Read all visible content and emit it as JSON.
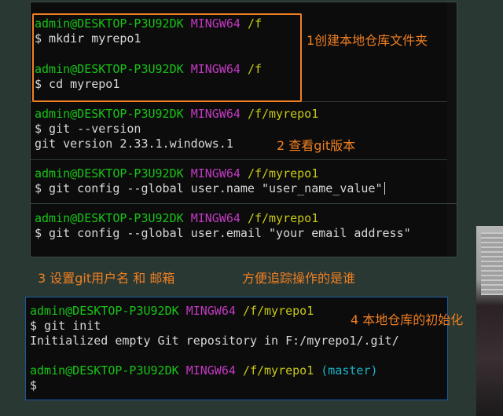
{
  "terminal1": {
    "blocks": [
      {
        "user": "admin@DESKTOP-P3U92DK",
        "sys": "MINGW64",
        "path": "/f",
        "cmd": "$ mkdir myrepo1",
        "output": ""
      },
      {
        "user": "admin@DESKTOP-P3U92DK",
        "sys": "MINGW64",
        "path": "/f",
        "cmd": "$ cd myrepo1",
        "output": ""
      },
      {
        "user": "admin@DESKTOP-P3U92DK",
        "sys": "MINGW64",
        "path": "/f/myrepo1",
        "cmd": "$ git --version",
        "output": "git version 2.33.1.windows.1"
      },
      {
        "user": "admin@DESKTOP-P3U92DK",
        "sys": "MINGW64",
        "path": "/f/myrepo1",
        "cmd": "$ git config --global user.name \"user_name_value\"",
        "output": ""
      },
      {
        "user": "admin@DESKTOP-P3U92DK",
        "sys": "MINGW64",
        "path": "/f/myrepo1",
        "cmd": "$ git config --global user.email \"your email address\"",
        "output": ""
      }
    ]
  },
  "terminal2": {
    "blocks": [
      {
        "user": "admin@DESKTOP-P3U92DK",
        "sys": "MINGW64",
        "path": "/f/myrepo1",
        "branch": "",
        "cmd": "$ git init",
        "output": "Initialized empty Git repository in F:/myrepo1/.git/"
      },
      {
        "user": "admin@DESKTOP-P3U92DK",
        "sys": "MINGW64",
        "path": "/f/myrepo1",
        "branch": "(master)",
        "cmd": "$",
        "output": ""
      }
    ]
  },
  "annotations": {
    "note1": "1创建本地仓库文件夹",
    "note2": "2 查看git版本",
    "note3a": "3 设置git用户名 和 邮箱",
    "note3b": "方便追踪操作的是谁",
    "note4": "4 本地仓库的初始化"
  },
  "colors": {
    "annotation": "#f07f22",
    "user": "#17c417",
    "system": "#c23ac2",
    "path": "#c8c81a",
    "branch": "#1ab4c8"
  }
}
